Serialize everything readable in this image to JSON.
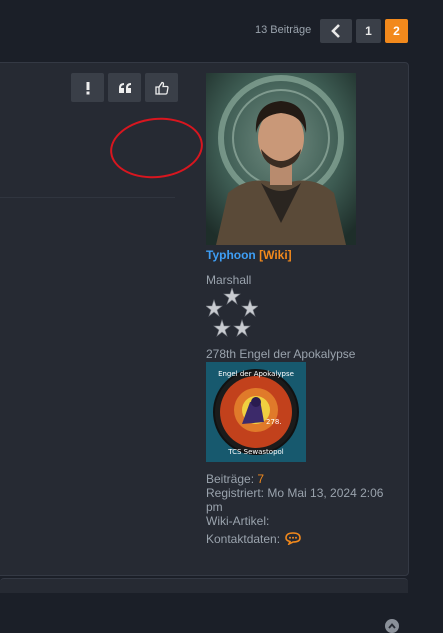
{
  "pagination": {
    "count_label": "13 Beiträge",
    "pages": [
      "1",
      "2"
    ],
    "active_page": "2"
  },
  "user": {
    "name": "Typhoon",
    "wiki": "[Wiki]",
    "rank": "Marshall",
    "team": "278th Engel der Apokalypse",
    "badge_text_top": "Engel der Apokalypse",
    "badge_text_bottom": "TCS Sewastopol",
    "badge_number": "278.",
    "posts_label": "Beiträge:",
    "posts_value": "7",
    "registered_label": "Registriert:",
    "registered_value": "Mo Mai 13, 2024 2:06 pm",
    "wiki_label": "Wiki-Artikel:",
    "contact_label": "Kontaktdaten:"
  },
  "icons": {
    "prev": "chevron-left-icon",
    "report": "exclamation-icon",
    "quote": "quote-icon",
    "like": "thumbs-up-icon",
    "contact": "chat-bubble-icon",
    "top": "arrow-up-icon"
  },
  "colors": {
    "accent": "#f2891c",
    "username": "#3e9ef5",
    "highlight": "#d8161f"
  }
}
